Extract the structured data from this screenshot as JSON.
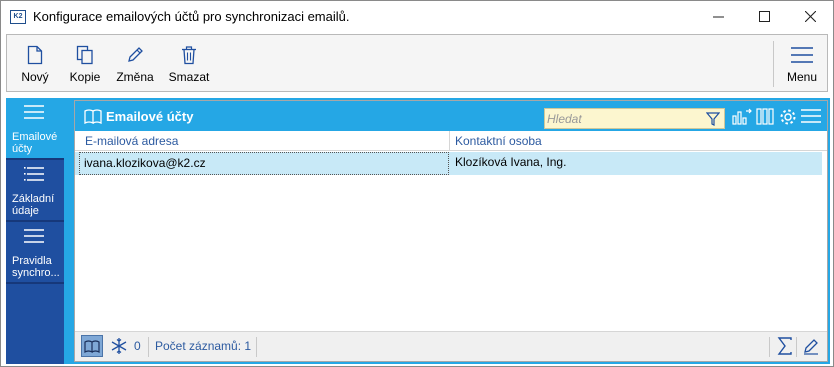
{
  "window": {
    "title": "Konfigurace emailových účtů pro synchronizaci emailů.",
    "app_icon_text": "K2"
  },
  "toolbar": {
    "new_label": "Nový",
    "copy_label": "Kopie",
    "edit_label": "Změna",
    "delete_label": "Smazat",
    "menu_label": "Menu"
  },
  "nav": {
    "items": [
      {
        "label": "Emailové účty",
        "icon": "list-icon",
        "active": true
      },
      {
        "label": "Základní údaje",
        "icon": "list-icon",
        "active": false
      },
      {
        "label": "Pravidla synchro...",
        "icon": "list-icon",
        "active": false
      }
    ]
  },
  "panel": {
    "title": "Emailové účty",
    "search_placeholder": "Hledat",
    "columns": [
      "E-mailová adresa",
      "Kontaktní osoba"
    ],
    "rows": [
      {
        "email": "ivana.klozikova@k2.cz",
        "contact": "Klozíková Ivana, Ing."
      }
    ]
  },
  "status": {
    "frozen_count": "0",
    "records_text": "Počet záznamů: 1"
  },
  "colors": {
    "accent": "#25a7e5",
    "nav_bg": "#1f4fa0",
    "selection": "#c8e9f7",
    "search_bg": "#fcf6cf"
  }
}
